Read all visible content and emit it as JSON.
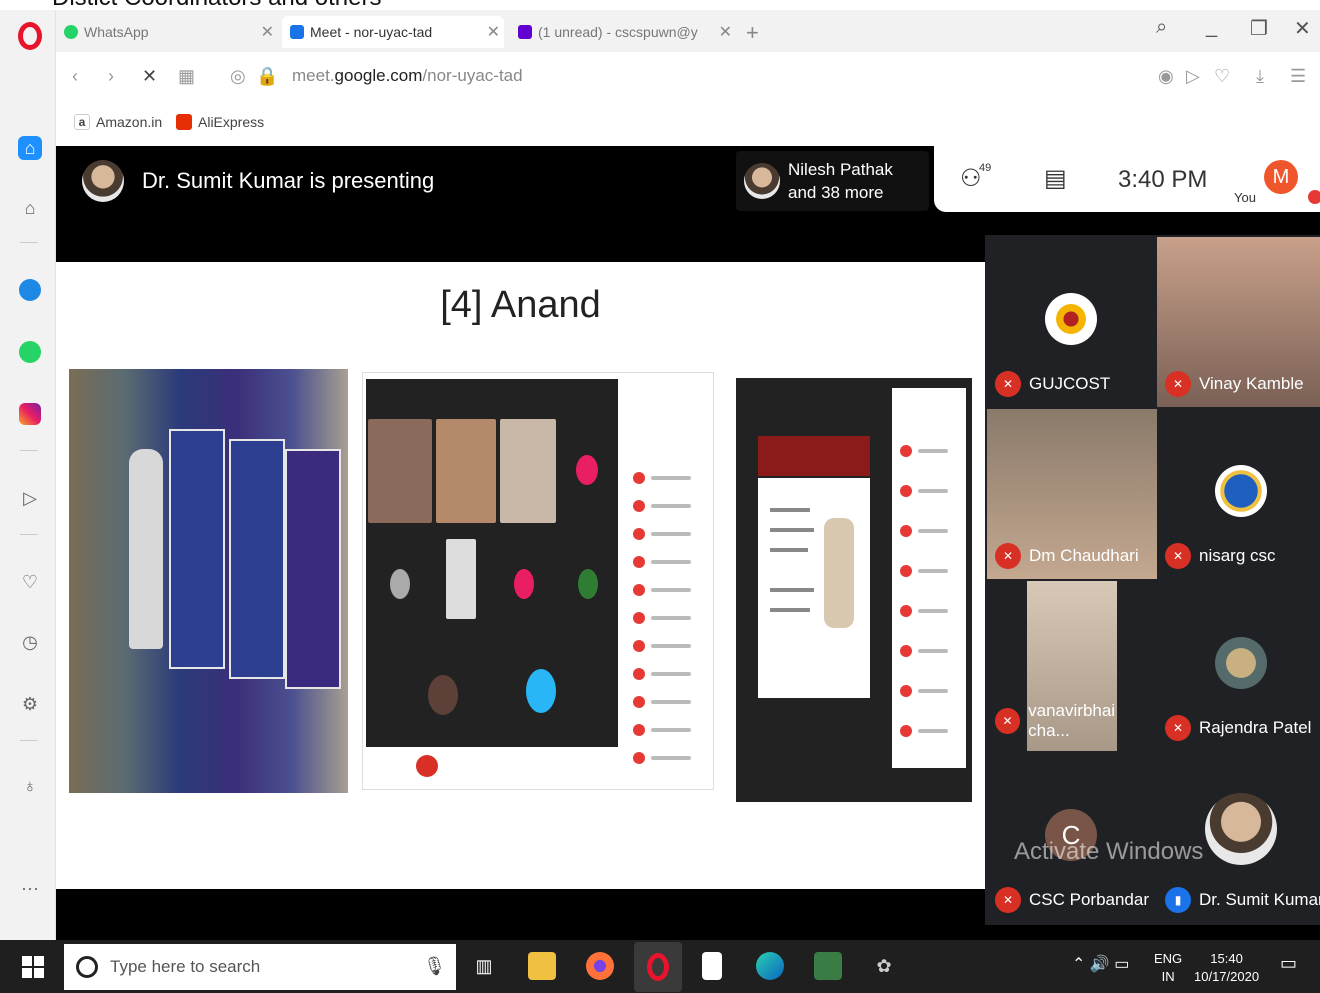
{
  "caption": "Distict Coordinators and others",
  "tabs": [
    {
      "label": "WhatsApp",
      "color": "#25d366"
    },
    {
      "label": "Meet - nor-uyac-tad",
      "color": "#1a73e8"
    },
    {
      "label": "(1 unread) - cscspuwn@y",
      "color": "#6001d2"
    }
  ],
  "url": {
    "prefix": "meet.",
    "domain": "google.com",
    "path": "/nor-uyac-tad"
  },
  "bookmarks": [
    {
      "label": "Amazon.in",
      "color": "#111"
    },
    {
      "label": "AliExpress",
      "color": "#e62e04"
    }
  ],
  "meet": {
    "presenting": "Dr. Sumit Kumar is presenting",
    "nilesh_line1": "Nilesh Pathak",
    "nilesh_line2": "and 38 more",
    "participant_count": "49",
    "clock": "3:40 PM",
    "you_label": "You",
    "you_initial": "M",
    "slide_title": "[4] Anand",
    "participants": [
      {
        "name": "GUJCOST"
      },
      {
        "name": "Vinay Kamble"
      },
      {
        "name": "Dm Chaudhari"
      },
      {
        "name": "nisarg csc"
      },
      {
        "name": "vanavirbhai cha..."
      },
      {
        "name": "Rajendra Patel"
      },
      {
        "name": "CSC Porbandar",
        "initial": "C"
      },
      {
        "name": "Dr. Sumit Kumar"
      }
    ],
    "watermark": "Activate Windows"
  },
  "taskbar": {
    "search_placeholder": "Type here to search",
    "lang1": "ENG",
    "lang2": "IN",
    "time": "15:40",
    "date": "10/17/2020"
  }
}
